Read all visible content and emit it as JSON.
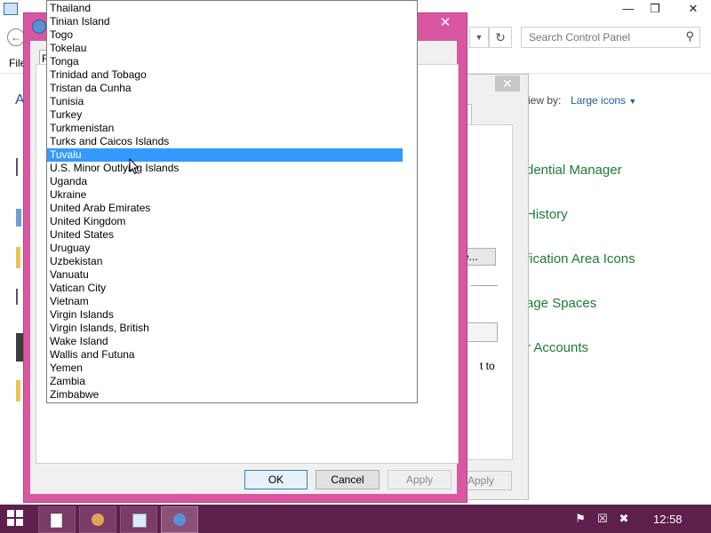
{
  "control_panel": {
    "search_placeholder": "Search Control Panel",
    "menu_file": "File",
    "heading_fragment": "A",
    "view_by_label": "iew by:",
    "view_by_value": "Large icons",
    "links": [
      "dential Manager",
      "History",
      "fication Area Icons",
      "age Spaces",
      "r Accounts"
    ]
  },
  "middle_dialog": {
    "ellipsis_button": "e...",
    "text_fragment": "t to",
    "apply_label": "Apply"
  },
  "region_dialog": {
    "tab_fragment": "F",
    "ok_label": "OK",
    "cancel_label": "Cancel",
    "apply_label": "Apply"
  },
  "country_list": {
    "items": [
      "Thailand",
      "Tinian Island",
      "Togo",
      "Tokelau",
      "Tonga",
      "Trinidad and Tobago",
      "Tristan da Cunha",
      "Tunisia",
      "Turkey",
      "Turkmenistan",
      "Turks and Caicos Islands",
      "Tuvalu",
      "U.S. Minor Outlying Islands",
      "Uganda",
      "Ukraine",
      "United Arab Emirates",
      "United Kingdom",
      "United States",
      "Uruguay",
      "Uzbekistan",
      "Vanuatu",
      "Vatican City",
      "Vietnam",
      "Virgin Islands",
      "Virgin Islands, British",
      "Wake Island",
      "Wallis and Futuna",
      "Yemen",
      "Zambia",
      "Zimbabwe"
    ],
    "selected": "Tuvalu"
  },
  "taskbar": {
    "clock": "12:58",
    "buttons": [
      "file-explorer",
      "users-tool",
      "control-panel-tool",
      "region-settings"
    ]
  },
  "colors": {
    "dialog_frame": "#d957a1",
    "taskbar": "#5d1f4b",
    "selection": "#3399ff",
    "link_green": "#1e7a3a"
  }
}
